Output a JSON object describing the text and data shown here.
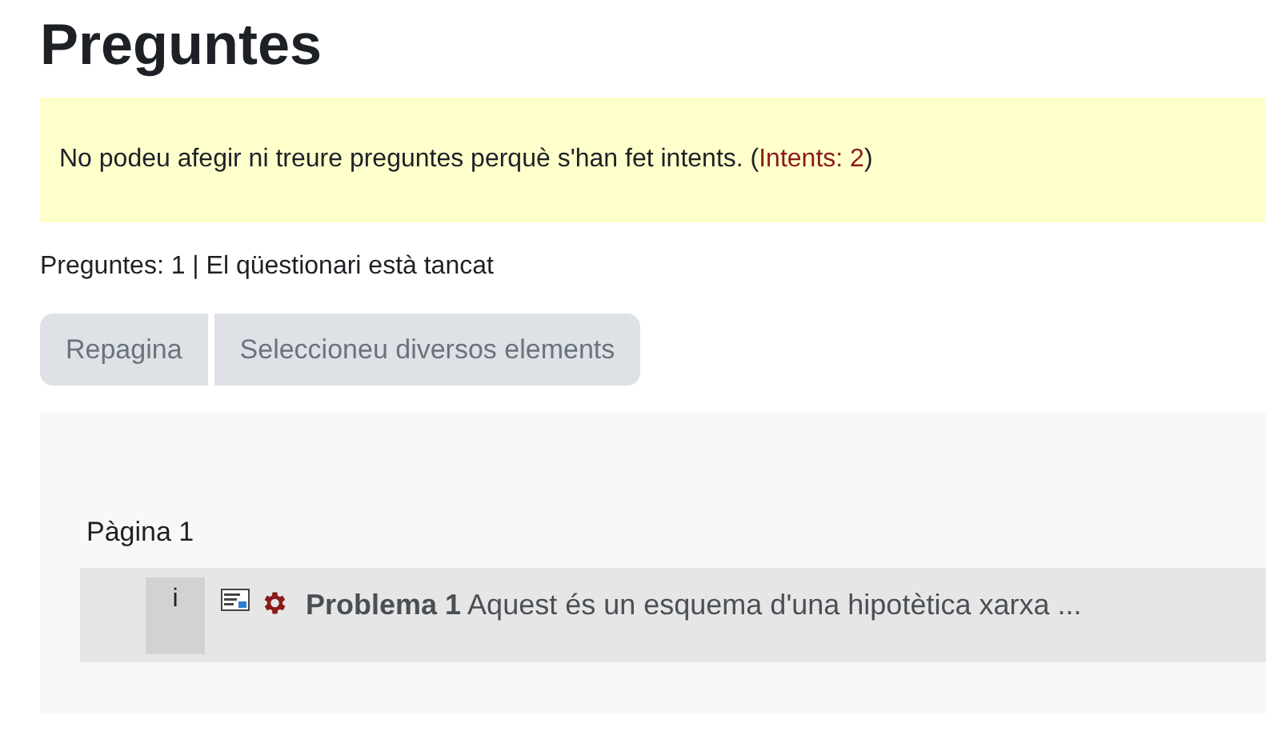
{
  "heading": "Preguntes",
  "alert": {
    "text_before": "No podeu afegir ni treure preguntes perquè s'han fet intents. (",
    "link": "Intents: 2",
    "text_after": ")"
  },
  "info": "Preguntes: 1 | El qüestionari està tancat",
  "buttons": [
    {
      "label": "Repagina",
      "disabled": true
    },
    {
      "label": "Seleccioneu diversos elements",
      "disabled": true
    }
  ],
  "page": {
    "label": "Pàgina 1",
    "questions": [
      {
        "number": "i",
        "text": "**Problema 1** Aquest és un esquema d'una hipotètica xarxa ..."
      }
    ]
  }
}
